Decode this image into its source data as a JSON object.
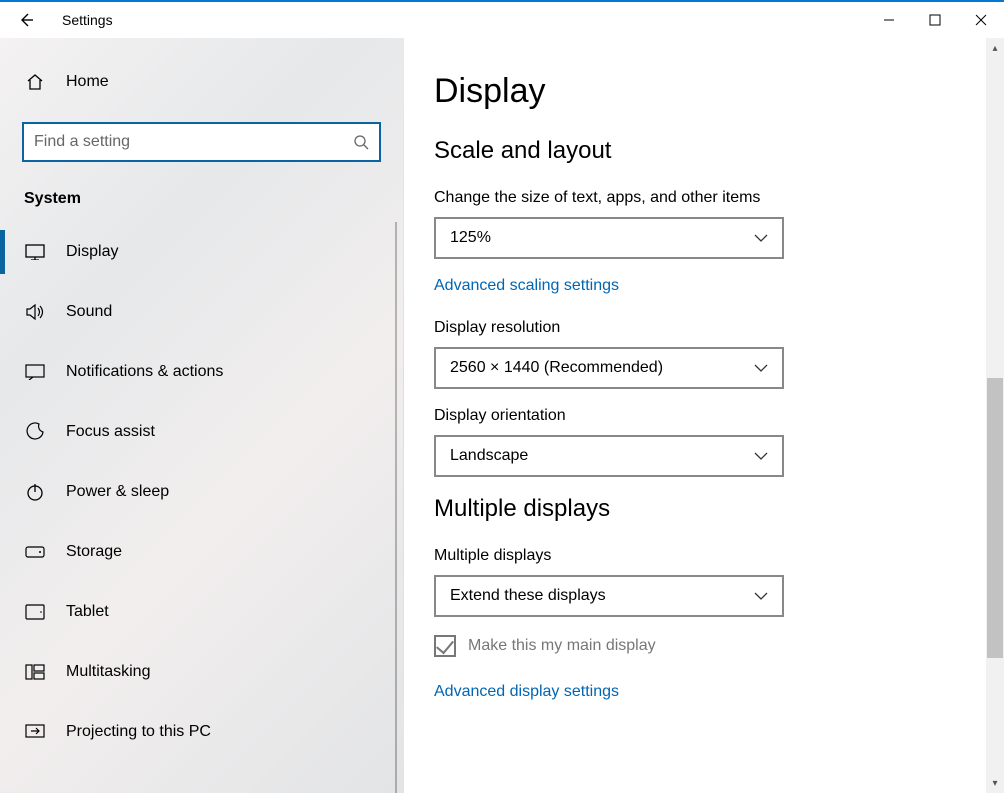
{
  "titlebar": {
    "title": "Settings"
  },
  "sidebar": {
    "home_label": "Home",
    "search_placeholder": "Find a setting",
    "category": "System",
    "items": [
      {
        "label": "Display"
      },
      {
        "label": "Sound"
      },
      {
        "label": "Notifications & actions"
      },
      {
        "label": "Focus assist"
      },
      {
        "label": "Power & sleep"
      },
      {
        "label": "Storage"
      },
      {
        "label": "Tablet"
      },
      {
        "label": "Multitasking"
      },
      {
        "label": "Projecting to this PC"
      }
    ]
  },
  "main": {
    "title": "Display",
    "section1": "Scale and layout",
    "scale_label": "Change the size of text, apps, and other items",
    "scale_value": "125%",
    "adv_scaling": "Advanced scaling settings",
    "res_label": "Display resolution",
    "res_value": "2560 × 1440 (Recommended)",
    "orient_label": "Display orientation",
    "orient_value": "Landscape",
    "section2": "Multiple displays",
    "multi_label": "Multiple displays",
    "multi_value": "Extend these displays",
    "main_display_chk": "Make this my main display",
    "adv_display": "Advanced display settings"
  }
}
